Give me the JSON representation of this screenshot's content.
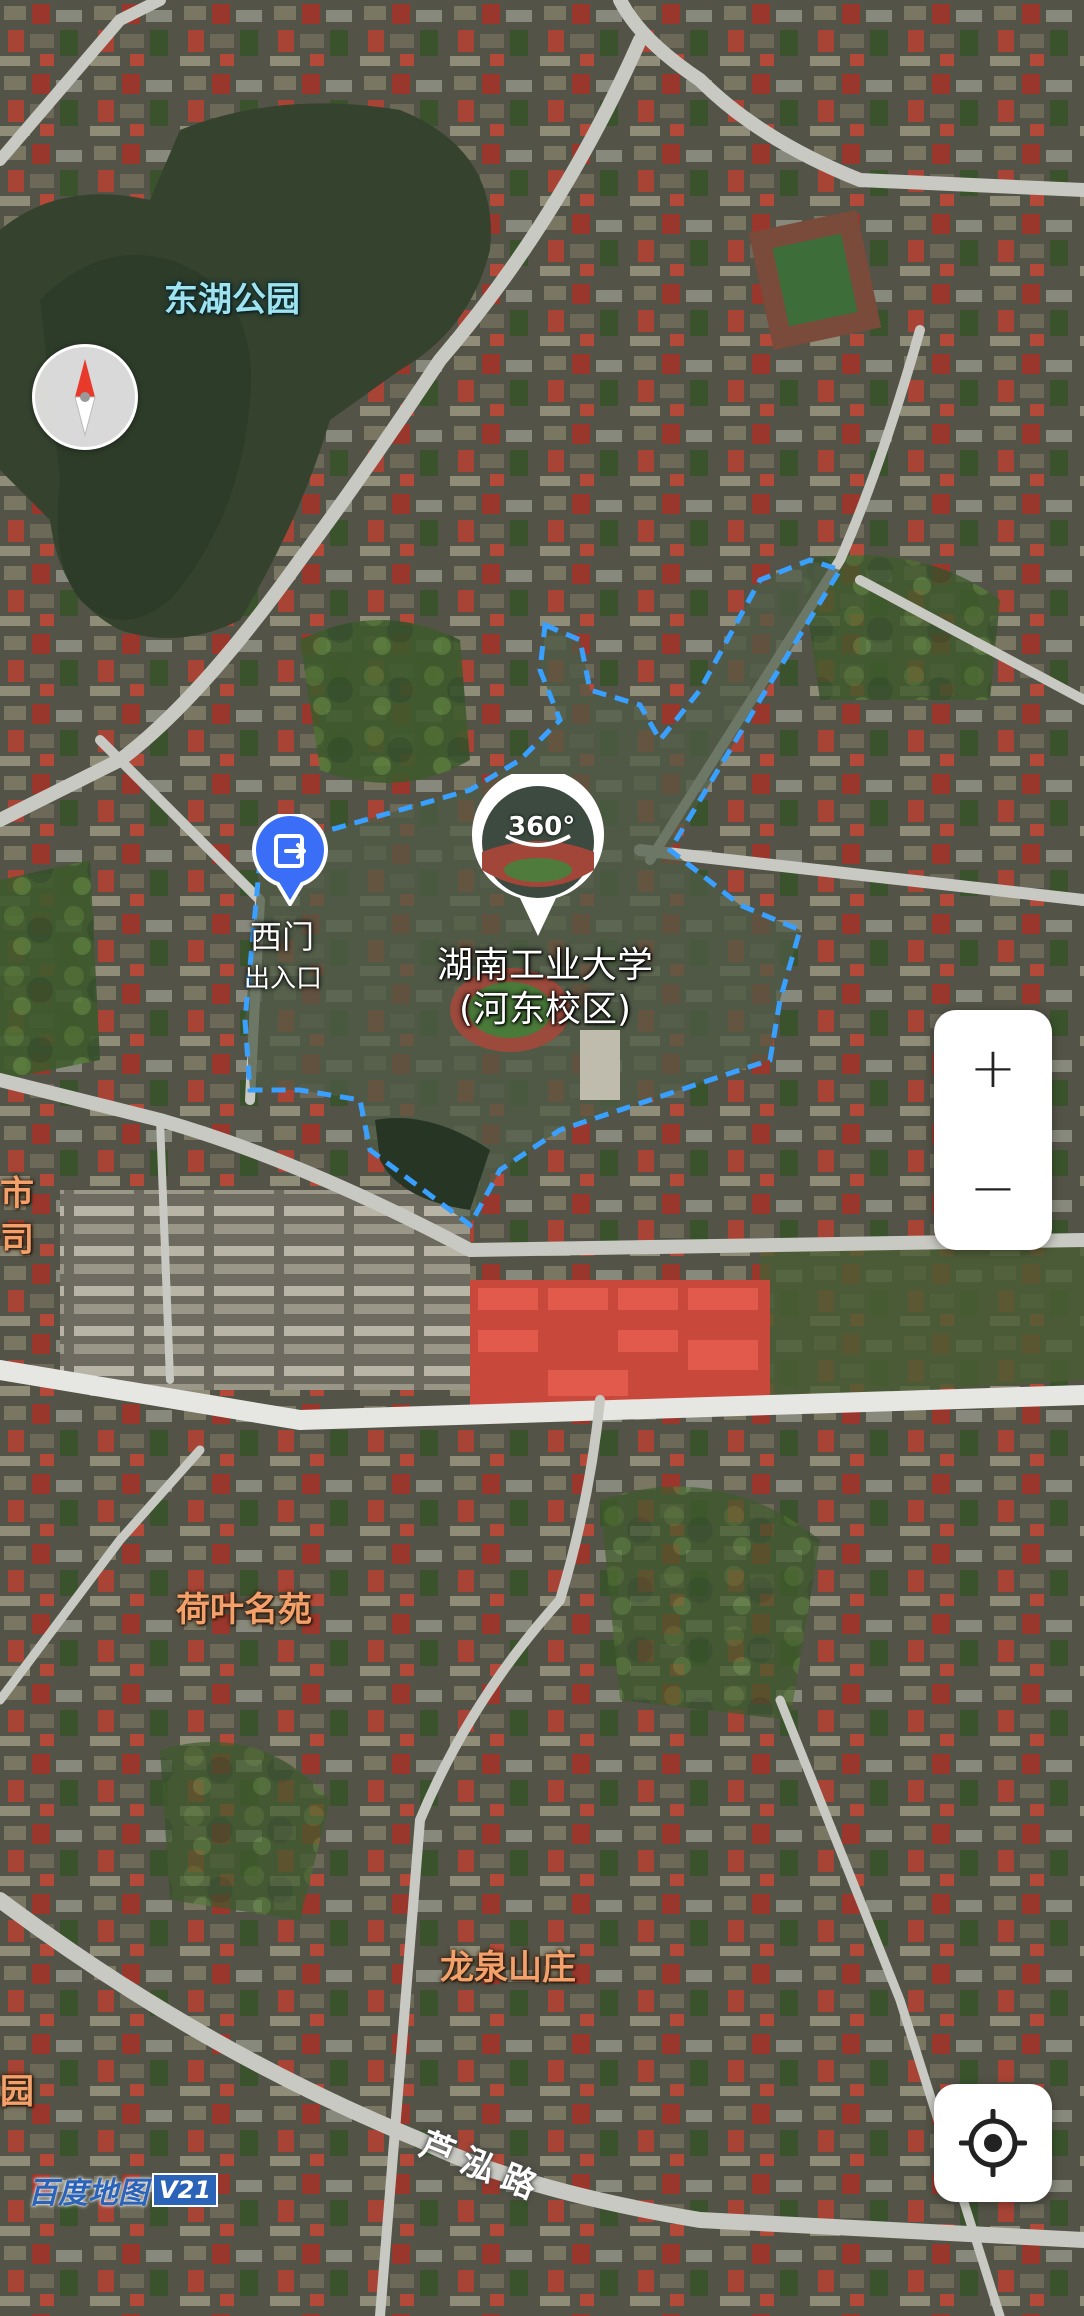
{
  "map": {
    "type": "satellite",
    "provider_watermark": "百度地图",
    "version_badge": "V21"
  },
  "labels": {
    "donghu_park": "东湖公园",
    "campus_line1": "湖南工业大学",
    "campus_line2": "(河东校区)",
    "west_gate": "西门",
    "west_gate_sub": "出入口",
    "heye_mingyuan": "荷叶名苑",
    "longquan_shanzhuang": "龙泉山庄",
    "road_luhong": "芦泓路",
    "edge_city": "市",
    "edge_company": "公司",
    "edge_garden": "花园"
  },
  "panorama": {
    "badge": "360°"
  },
  "controls": {
    "zoom_in": "+",
    "zoom_out": "−"
  },
  "colors": {
    "boundary": "#39a0ff",
    "area_label": "#f3a06a",
    "water_label": "#9fe3f0",
    "gate_pin": "#3b6ef6"
  },
  "icons": [
    "compass-icon",
    "panorama-360-icon",
    "entrance-icon",
    "locate-icon"
  ]
}
